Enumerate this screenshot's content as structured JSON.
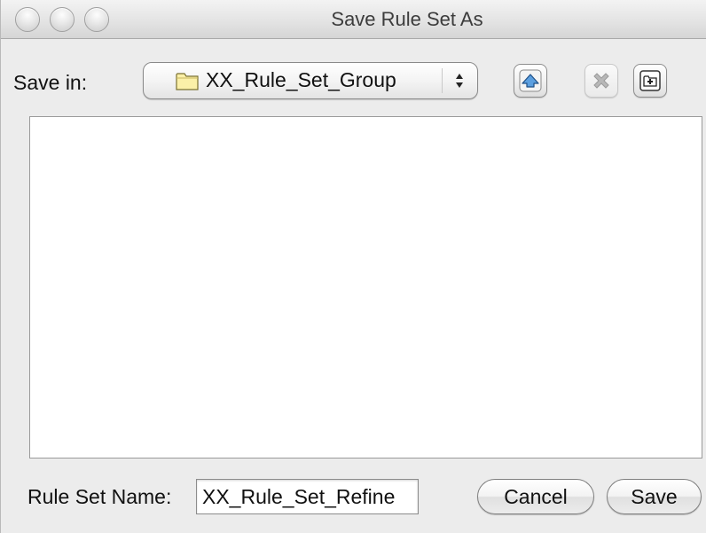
{
  "window": {
    "title": "Save Rule Set As"
  },
  "save_in": {
    "label": "Save in:",
    "selected_folder": "XX_Rule_Set_Group",
    "folder_icon": "folder-icon"
  },
  "toolbar": {
    "up_icon": "up-one-level-icon",
    "delete_icon": "delete-icon",
    "new_folder_icon": "new-folder-icon"
  },
  "file_list": {
    "items": []
  },
  "rule_set_name": {
    "label": "Rule Set Name:",
    "value": "XX_Rule_Set_Refine"
  },
  "buttons": {
    "cancel_label": "Cancel",
    "save_label": "Save"
  }
}
